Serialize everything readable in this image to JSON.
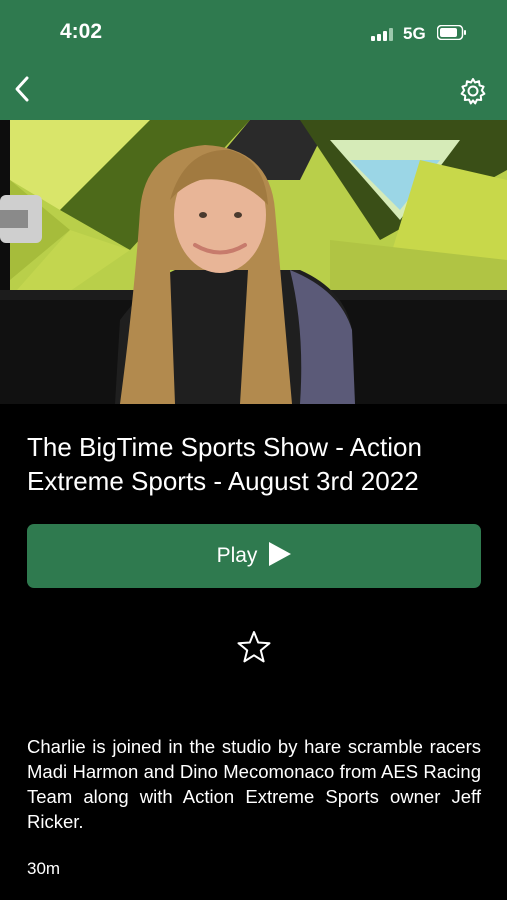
{
  "status_bar": {
    "time": "4:02",
    "network": "5G",
    "signal_icon": "cellular-signal-icon",
    "battery_icon": "battery-icon"
  },
  "nav": {
    "back_icon": "chevron-left-icon",
    "settings_icon": "gear-icon"
  },
  "hero": {
    "image": "hero-thumbnail"
  },
  "episode": {
    "title": "The BigTime Sports Show - Action Extreme Sports - August 3rd 2022",
    "play_label": "Play",
    "play_icon": "play-triangle-icon",
    "favorite_icon": "star-outline-icon",
    "description": "Charlie is joined in the studio by hare scramble racers Madi Harmon and Dino Mecomonaco from AES Racing Team along with Action Extreme Sports owner Jeff Ricker.",
    "duration": "30m"
  },
  "colors": {
    "brand_green": "#2f7a4f",
    "background": "#000000",
    "text": "#ffffff"
  }
}
